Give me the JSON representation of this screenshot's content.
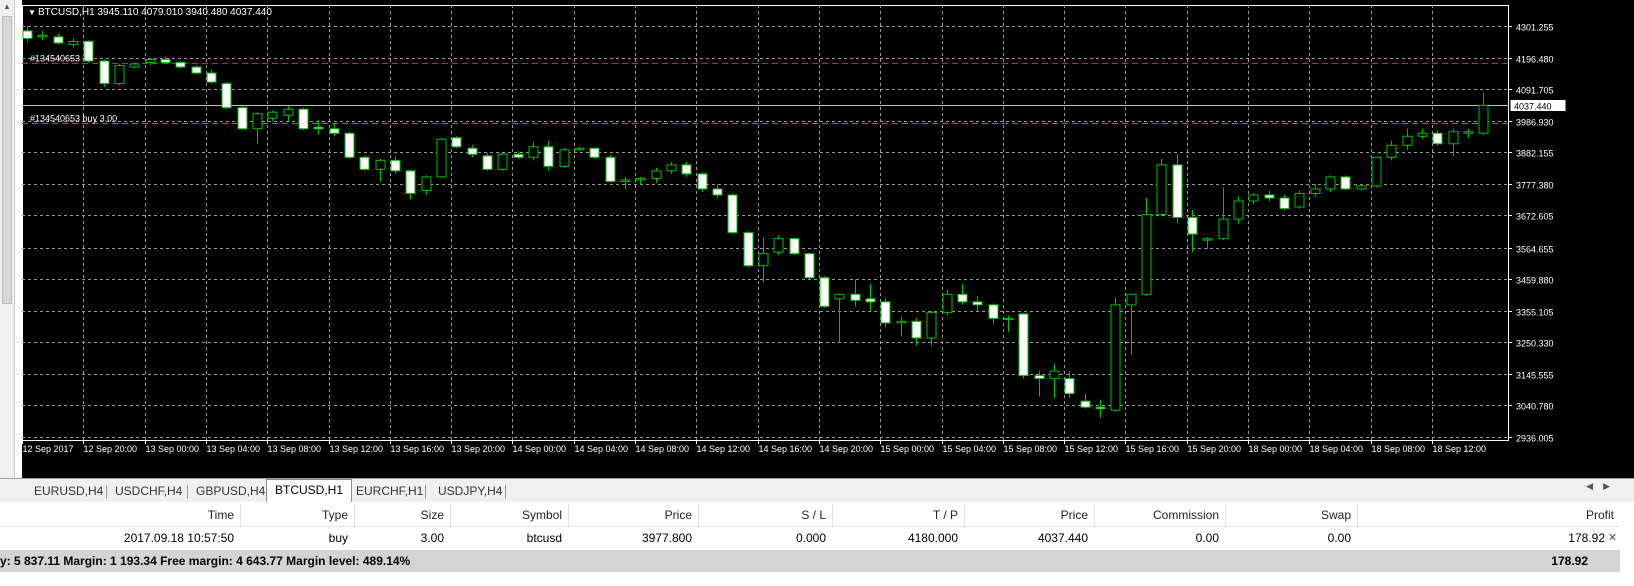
{
  "chart": {
    "header": "BTCUSD,H1  3945.110 4079.010 3940.480 4037.440",
    "current_price": "4037.440",
    "orders": [
      "#134540653",
      "#134540653 buy 3.00"
    ],
    "price_ticks": [
      "4301.255",
      "4196.480",
      "4091.705",
      "3986.930",
      "3882.155",
      "3777.380",
      "3672.605",
      "3564.655",
      "3459.880",
      "3355.105",
      "3250.330",
      "3145.555",
      "3040.780",
      "2936.005"
    ],
    "time_ticks": [
      "12 Sep 2017",
      "12 Sep 20:00",
      "13 Sep 00:00",
      "13 Sep 04:00",
      "13 Sep 08:00",
      "13 Sep 12:00",
      "13 Sep 16:00",
      "13 Sep 20:00",
      "14 Sep 00:00",
      "14 Sep 04:00",
      "14 Sep 08:00",
      "14 Sep 12:00",
      "14 Sep 16:00",
      "14 Sep 20:00",
      "15 Sep 00:00",
      "15 Sep 04:00",
      "15 Sep 08:00",
      "15 Sep 12:00",
      "15 Sep 16:00",
      "15 Sep 20:00",
      "18 Sep 00:00",
      "18 Sep 04:00",
      "18 Sep 08:00",
      "18 Sep 12:00"
    ],
    "colors": {
      "background": "#000000",
      "grid": "#9a9a9a",
      "bull_candle": "#000000",
      "bear_candle": "#ffffff",
      "wick": "#00c000",
      "take_profit_line": "#c82828",
      "entry_line": "#28a028",
      "price_line": "#c0c0c0"
    },
    "take_profit": 4180.0,
    "entry_price": 3977.8
  },
  "chart_data": {
    "type": "candlestick",
    "symbol": "BTCUSD",
    "timeframe": "H1",
    "ylim": [
      2936.005,
      4301.255
    ],
    "candles": [
      {
        "o": 4285,
        "h": 4300,
        "l": 4250,
        "c": 4260
      },
      {
        "o": 4265,
        "h": 4285,
        "l": 4255,
        "c": 4270
      },
      {
        "o": 4265,
        "h": 4275,
        "l": 4240,
        "c": 4245
      },
      {
        "o": 4240,
        "h": 4260,
        "l": 4230,
        "c": 4250
      },
      {
        "o": 4250,
        "h": 4255,
        "l": 4180,
        "c": 4185
      },
      {
        "o": 4185,
        "h": 4190,
        "l": 4100,
        "c": 4110
      },
      {
        "o": 4110,
        "h": 4175,
        "l": 4105,
        "c": 4170
      },
      {
        "o": 4165,
        "h": 4180,
        "l": 4160,
        "c": 4175
      },
      {
        "o": 4180,
        "h": 4195,
        "l": 4170,
        "c": 4190
      },
      {
        "o": 4190,
        "h": 4200,
        "l": 4175,
        "c": 4180
      },
      {
        "o": 4180,
        "h": 4185,
        "l": 4160,
        "c": 4165
      },
      {
        "o": 4165,
        "h": 4170,
        "l": 4140,
        "c": 4145
      },
      {
        "o": 4145,
        "h": 4155,
        "l": 4110,
        "c": 4115
      },
      {
        "o": 4110,
        "h": 4115,
        "l": 4025,
        "c": 4030
      },
      {
        "o": 4030,
        "h": 4035,
        "l": 3955,
        "c": 3960
      },
      {
        "o": 3960,
        "h": 4015,
        "l": 3910,
        "c": 4010
      },
      {
        "o": 3995,
        "h": 4020,
        "l": 3985,
        "c": 4015
      },
      {
        "o": 4005,
        "h": 4035,
        "l": 3985,
        "c": 4025
      },
      {
        "o": 4025,
        "h": 4030,
        "l": 3955,
        "c": 3960
      },
      {
        "o": 3965,
        "h": 3990,
        "l": 3940,
        "c": 3960
      },
      {
        "o": 3960,
        "h": 3975,
        "l": 3935,
        "c": 3945
      },
      {
        "o": 3945,
        "h": 3950,
        "l": 3860,
        "c": 3865
      },
      {
        "o": 3865,
        "h": 3870,
        "l": 3820,
        "c": 3825
      },
      {
        "o": 3825,
        "h": 3860,
        "l": 3785,
        "c": 3855
      },
      {
        "o": 3855,
        "h": 3870,
        "l": 3810,
        "c": 3820
      },
      {
        "o": 3820,
        "h": 3825,
        "l": 3725,
        "c": 3745
      },
      {
        "o": 3755,
        "h": 3805,
        "l": 3740,
        "c": 3800
      },
      {
        "o": 3800,
        "h": 3930,
        "l": 3795,
        "c": 3925
      },
      {
        "o": 3930,
        "h": 3935,
        "l": 3895,
        "c": 3900
      },
      {
        "o": 3895,
        "h": 3905,
        "l": 3865,
        "c": 3875
      },
      {
        "o": 3870,
        "h": 3880,
        "l": 3820,
        "c": 3825
      },
      {
        "o": 3825,
        "h": 3880,
        "l": 3820,
        "c": 3875
      },
      {
        "o": 3875,
        "h": 3885,
        "l": 3860,
        "c": 3865
      },
      {
        "o": 3865,
        "h": 3915,
        "l": 3855,
        "c": 3900
      },
      {
        "o": 3900,
        "h": 3920,
        "l": 3820,
        "c": 3835
      },
      {
        "o": 3835,
        "h": 3895,
        "l": 3830,
        "c": 3890
      },
      {
        "o": 3890,
        "h": 3900,
        "l": 3885,
        "c": 3895
      },
      {
        "o": 3895,
        "h": 3895,
        "l": 3860,
        "c": 3865
      },
      {
        "o": 3865,
        "h": 3875,
        "l": 3780,
        "c": 3785
      },
      {
        "o": 3785,
        "h": 3800,
        "l": 3760,
        "c": 3790
      },
      {
        "o": 3790,
        "h": 3800,
        "l": 3775,
        "c": 3795
      },
      {
        "o": 3795,
        "h": 3830,
        "l": 3780,
        "c": 3820
      },
      {
        "o": 3820,
        "h": 3850,
        "l": 3810,
        "c": 3840
      },
      {
        "o": 3840,
        "h": 3850,
        "l": 3800,
        "c": 3810
      },
      {
        "o": 3810,
        "h": 3815,
        "l": 3750,
        "c": 3760
      },
      {
        "o": 3760,
        "h": 3775,
        "l": 3730,
        "c": 3740
      },
      {
        "o": 3740,
        "h": 3745,
        "l": 3610,
        "c": 3615
      },
      {
        "o": 3615,
        "h": 3620,
        "l": 3500,
        "c": 3505
      },
      {
        "o": 3505,
        "h": 3600,
        "l": 3450,
        "c": 3545
      },
      {
        "o": 3550,
        "h": 3605,
        "l": 3540,
        "c": 3595
      },
      {
        "o": 3595,
        "h": 3600,
        "l": 3540,
        "c": 3545
      },
      {
        "o": 3545,
        "h": 3550,
        "l": 3460,
        "c": 3465
      },
      {
        "o": 3465,
        "h": 3470,
        "l": 3365,
        "c": 3370
      },
      {
        "o": 3395,
        "h": 3410,
        "l": 3250,
        "c": 3410
      },
      {
        "o": 3410,
        "h": 3460,
        "l": 3370,
        "c": 3390
      },
      {
        "o": 3395,
        "h": 3445,
        "l": 3355,
        "c": 3385
      },
      {
        "o": 3385,
        "h": 3400,
        "l": 3300,
        "c": 3315
      },
      {
        "o": 3315,
        "h": 3335,
        "l": 3270,
        "c": 3320
      },
      {
        "o": 3320,
        "h": 3330,
        "l": 3240,
        "c": 3265
      },
      {
        "o": 3265,
        "h": 3355,
        "l": 3240,
        "c": 3350
      },
      {
        "o": 3350,
        "h": 3425,
        "l": 3340,
        "c": 3410
      },
      {
        "o": 3410,
        "h": 3445,
        "l": 3375,
        "c": 3385
      },
      {
        "o": 3385,
        "h": 3405,
        "l": 3355,
        "c": 3375
      },
      {
        "o": 3375,
        "h": 3380,
        "l": 3310,
        "c": 3330
      },
      {
        "o": 3330,
        "h": 3340,
        "l": 3285,
        "c": 3330
      },
      {
        "o": 3345,
        "h": 3345,
        "l": 3130,
        "c": 3140
      },
      {
        "o": 3140,
        "h": 3155,
        "l": 3070,
        "c": 3130
      },
      {
        "o": 3130,
        "h": 3180,
        "l": 3065,
        "c": 3155
      },
      {
        "o": 3130,
        "h": 3155,
        "l": 3065,
        "c": 3080
      },
      {
        "o": 3055,
        "h": 3080,
        "l": 3030,
        "c": 3035
      },
      {
        "o": 3035,
        "h": 3060,
        "l": 3000,
        "c": 3030
      },
      {
        "o": 3025,
        "h": 3400,
        "l": 3020,
        "c": 3375
      },
      {
        "o": 3375,
        "h": 3410,
        "l": 3210,
        "c": 3410
      },
      {
        "o": 3410,
        "h": 3730,
        "l": 3405,
        "c": 3675
      },
      {
        "o": 3675,
        "h": 3860,
        "l": 3670,
        "c": 3840
      },
      {
        "o": 3840,
        "h": 3875,
        "l": 3645,
        "c": 3665
      },
      {
        "o": 3665,
        "h": 3690,
        "l": 3550,
        "c": 3610
      },
      {
        "o": 3590,
        "h": 3600,
        "l": 3560,
        "c": 3595
      },
      {
        "o": 3595,
        "h": 3765,
        "l": 3590,
        "c": 3660
      },
      {
        "o": 3660,
        "h": 3735,
        "l": 3645,
        "c": 3720
      },
      {
        "o": 3720,
        "h": 3745,
        "l": 3710,
        "c": 3740
      },
      {
        "o": 3740,
        "h": 3755,
        "l": 3720,
        "c": 3730
      },
      {
        "o": 3730,
        "h": 3740,
        "l": 3690,
        "c": 3695
      },
      {
        "o": 3700,
        "h": 3755,
        "l": 3695,
        "c": 3745
      },
      {
        "o": 3745,
        "h": 3775,
        "l": 3735,
        "c": 3760
      },
      {
        "o": 3760,
        "h": 3805,
        "l": 3750,
        "c": 3800
      },
      {
        "o": 3800,
        "h": 3805,
        "l": 3755,
        "c": 3760
      },
      {
        "o": 3760,
        "h": 3775,
        "l": 3755,
        "c": 3770
      },
      {
        "o": 3770,
        "h": 3865,
        "l": 3765,
        "c": 3865
      },
      {
        "o": 3865,
        "h": 3920,
        "l": 3855,
        "c": 3905
      },
      {
        "o": 3905,
        "h": 3960,
        "l": 3890,
        "c": 3935
      },
      {
        "o": 3935,
        "h": 3960,
        "l": 3925,
        "c": 3945
      },
      {
        "o": 3945,
        "h": 3955,
        "l": 3905,
        "c": 3910
      },
      {
        "o": 3910,
        "h": 3960,
        "l": 3870,
        "c": 3950
      },
      {
        "o": 3945,
        "h": 3960,
        "l": 3930,
        "c": 3950
      },
      {
        "o": 3945,
        "h": 4079.01,
        "l": 3940.48,
        "c": 4037.44
      }
    ]
  },
  "tabs": [
    {
      "label": "EURUSD,H4",
      "active": false
    },
    {
      "label": "USDCHF,H4",
      "active": false
    },
    {
      "label": "GBPUSD,H4",
      "active": false
    },
    {
      "label": "BTCUSD,H1",
      "active": true
    },
    {
      "label": "EURCHF,H1",
      "active": false
    },
    {
      "label": "USDJPY,H4",
      "active": false
    }
  ],
  "trade": {
    "headers": {
      "time": "Time",
      "type": "Type",
      "size": "Size",
      "symbol": "Symbol",
      "price": "Price",
      "sl": "S / L",
      "tp": "T / P",
      "price2": "Price",
      "commission": "Commission",
      "swap": "Swap",
      "profit": "Profit"
    },
    "row": {
      "time": "2017.09.18 10:57:50",
      "type": "buy",
      "size": "3.00",
      "symbol": "btcusd",
      "price": "3977.800",
      "sl": "0.000",
      "tp": "4180.000",
      "price2": "4037.440",
      "commission": "0.00",
      "swap": "0.00",
      "profit": "178.92"
    },
    "summary": "y: 5 837.11  Margin: 1 193.34  Free margin: 4 643.77  Margin level: 489.14%",
    "summary_profit": "178.92"
  }
}
